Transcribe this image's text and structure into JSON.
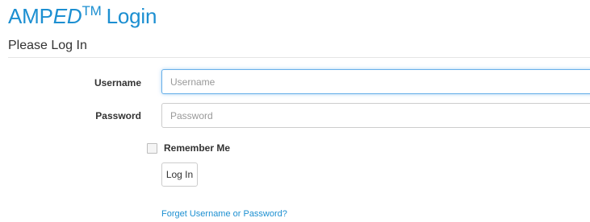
{
  "header": {
    "brand_prefix": "AMP",
    "brand_italic": "ED",
    "brand_tm": "TM",
    "title_suffix": "Login",
    "subtitle": "Please Log In"
  },
  "form": {
    "username_label": "Username",
    "username_value": "",
    "username_placeholder": "Username",
    "password_label": "Password",
    "password_value": "",
    "password_placeholder": "Password",
    "remember_label": "Remember Me",
    "remember_checked": false,
    "login_button_label": "Log In",
    "forgot_link_text": "Forget Username or Password?"
  },
  "colors": {
    "accent": "#1c8fd1",
    "focus_border": "#66afe9",
    "input_border": "#cccccc"
  }
}
